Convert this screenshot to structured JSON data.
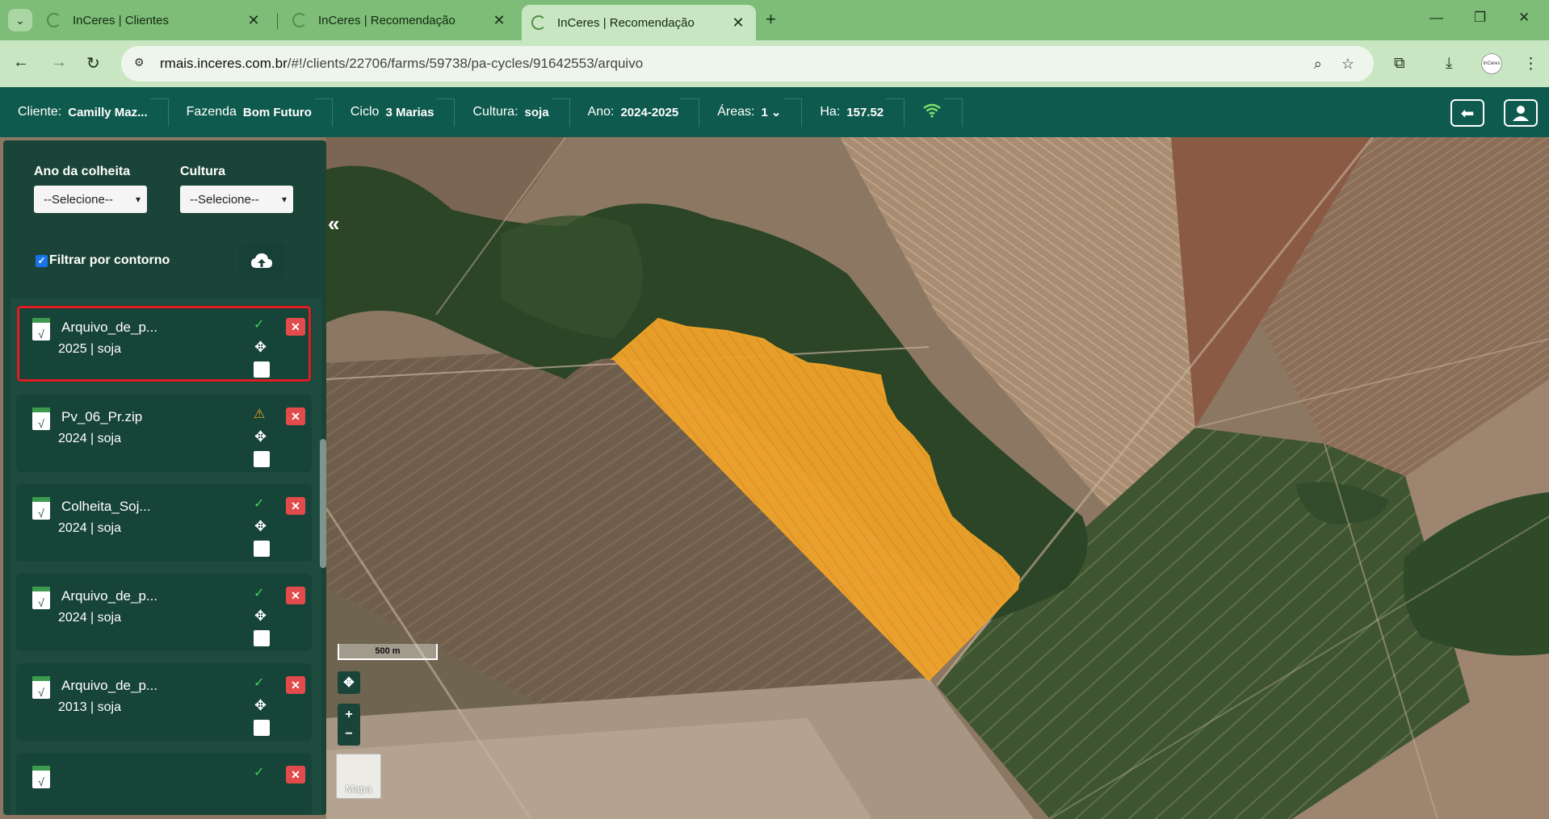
{
  "browser": {
    "tabs": [
      {
        "title": "InCeres | Clientes",
        "active": false
      },
      {
        "title": "InCeres | Recomendação",
        "active": false
      },
      {
        "title": "InCeres | Recomendação",
        "active": true
      }
    ],
    "url_host": "rmais.inceres.com.br",
    "url_path": "/#!/clients/22706/farms/59738/pa-cycles/91642553/arquivo",
    "profile_text": "InCeres"
  },
  "header": {
    "crumbs": [
      {
        "label": "Cliente:",
        "value": "Camilly Maz..."
      },
      {
        "label": "Fazenda",
        "value": "Bom Futuro"
      },
      {
        "label": "Ciclo",
        "value": "3 Marias"
      },
      {
        "label": "Cultura:",
        "value": "soja"
      },
      {
        "label": "Ano:",
        "value": "2024-2025"
      },
      {
        "label": "Áreas:",
        "value": "1"
      },
      {
        "label": "Ha:",
        "value": "157.52"
      }
    ]
  },
  "panel": {
    "year_label": "Ano da colheita",
    "year_value": "--Selecione--",
    "crop_label": "Cultura",
    "crop_value": "--Selecione--",
    "filter_label": "Filtrar por contorno",
    "files": [
      {
        "name": "Arquivo_de_p...",
        "sub": "2025 | soja",
        "status": "ok"
      },
      {
        "name": "Pv_06_Pr.zip",
        "sub": "2024 | soja",
        "status": "warn"
      },
      {
        "name": "Colheita_Soj...",
        "sub": "2024 | soja",
        "status": "ok"
      },
      {
        "name": "Arquivo_de_p...",
        "sub": "2024 | soja",
        "status": "ok"
      },
      {
        "name": "Arquivo_de_p...",
        "sub": "2013 | soja",
        "status": "ok"
      }
    ]
  },
  "map": {
    "scale_label": "500 m",
    "basemap_label": "Mapa",
    "field_color": "#f5a623"
  }
}
